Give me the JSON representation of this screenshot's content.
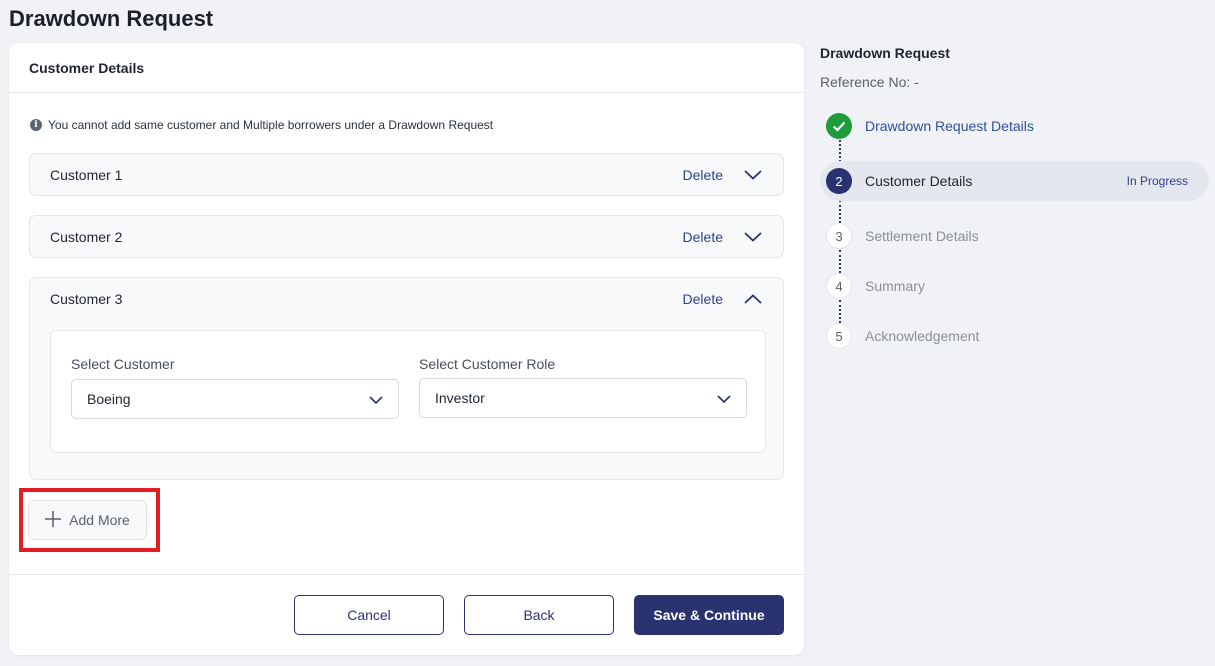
{
  "page": {
    "title": "Drawdown Request"
  },
  "form": {
    "section_title": "Customer Details",
    "info_note": "You cannot add same customer and Multiple borrowers under a Drawdown Request",
    "customers": [
      {
        "title": "Customer 1",
        "delete_label": "Delete",
        "expanded": false
      },
      {
        "title": "Customer 2",
        "delete_label": "Delete",
        "expanded": false
      },
      {
        "title": "Customer 3",
        "delete_label": "Delete",
        "expanded": true,
        "select_customer_label": "Select Customer",
        "select_customer_value": "Boeing",
        "select_role_label": "Select Customer Role",
        "select_role_value": "Investor"
      }
    ],
    "add_more_label": "Add More",
    "buttons": {
      "cancel": "Cancel",
      "back": "Back",
      "save": "Save & Continue"
    }
  },
  "sidebar": {
    "title": "Drawdown Request",
    "reference": "Reference No: -",
    "steps": [
      {
        "number": "1",
        "label": "Drawdown Request Details",
        "state": "done"
      },
      {
        "number": "2",
        "label": "Customer Details",
        "state": "current",
        "status": "In Progress"
      },
      {
        "number": "3",
        "label": "Settlement Details",
        "state": "pending"
      },
      {
        "number": "4",
        "label": "Summary",
        "state": "pending"
      },
      {
        "number": "5",
        "label": "Acknowledgement",
        "state": "pending"
      }
    ]
  },
  "colors": {
    "primary": "#2b3270",
    "link": "#2f3f8f",
    "success": "#1e9b3b",
    "highlight": "#e21d24",
    "background": "#f0f2f5"
  }
}
